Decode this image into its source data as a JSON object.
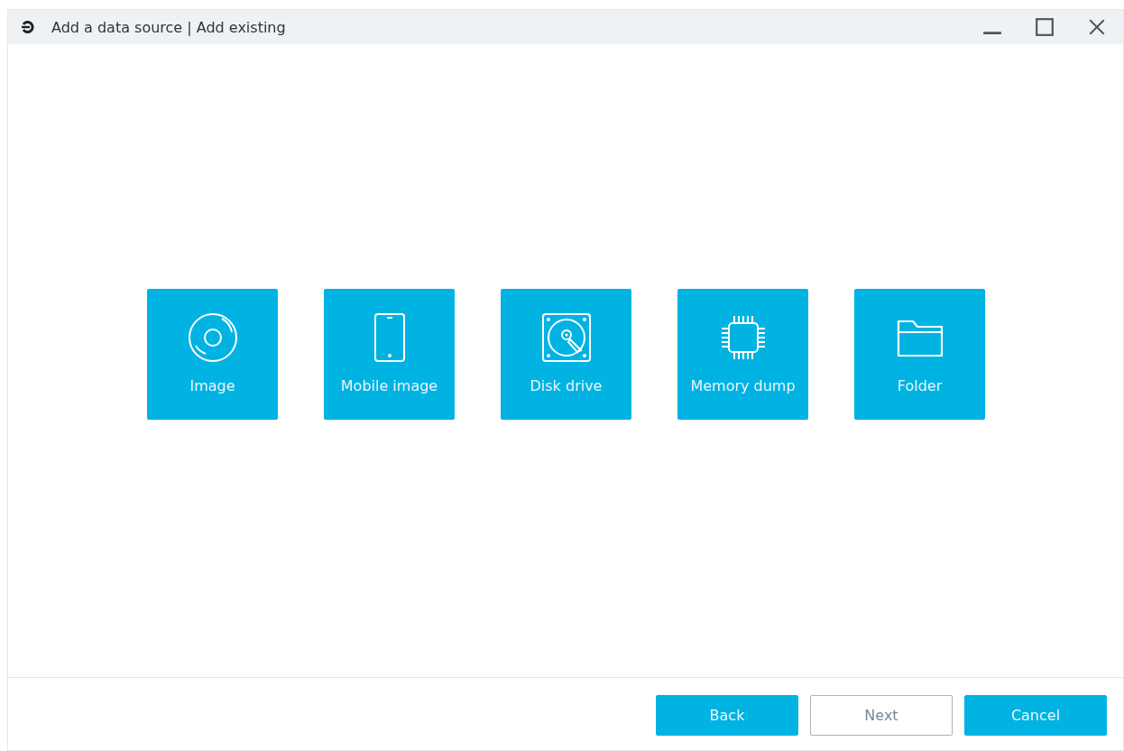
{
  "window": {
    "title": "Add a data source | Add existing"
  },
  "sources": [
    {
      "kind": "disc",
      "label": "Image"
    },
    {
      "kind": "phone",
      "label": "Mobile image"
    },
    {
      "kind": "drive",
      "label": "Disk drive"
    },
    {
      "kind": "chip",
      "label": "Memory dump"
    },
    {
      "kind": "folder",
      "label": "Folder"
    }
  ],
  "buttons": [
    {
      "label": "Back",
      "disabled": false
    },
    {
      "label": "Next",
      "disabled": true
    },
    {
      "label": "Cancel",
      "disabled": false
    }
  ]
}
